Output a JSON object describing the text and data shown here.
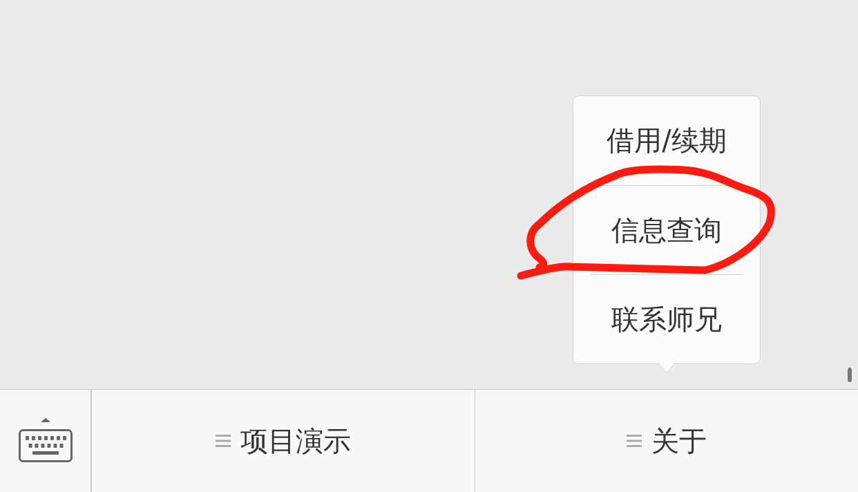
{
  "menu_bar": {
    "items": [
      {
        "label": "项目演示"
      },
      {
        "label": "关于",
        "submenu": [
          {
            "label": "借用/续期",
            "highlighted": false
          },
          {
            "label": "信息查询",
            "highlighted": true
          },
          {
            "label": "联系师兄",
            "highlighted": false
          }
        ]
      }
    ]
  }
}
